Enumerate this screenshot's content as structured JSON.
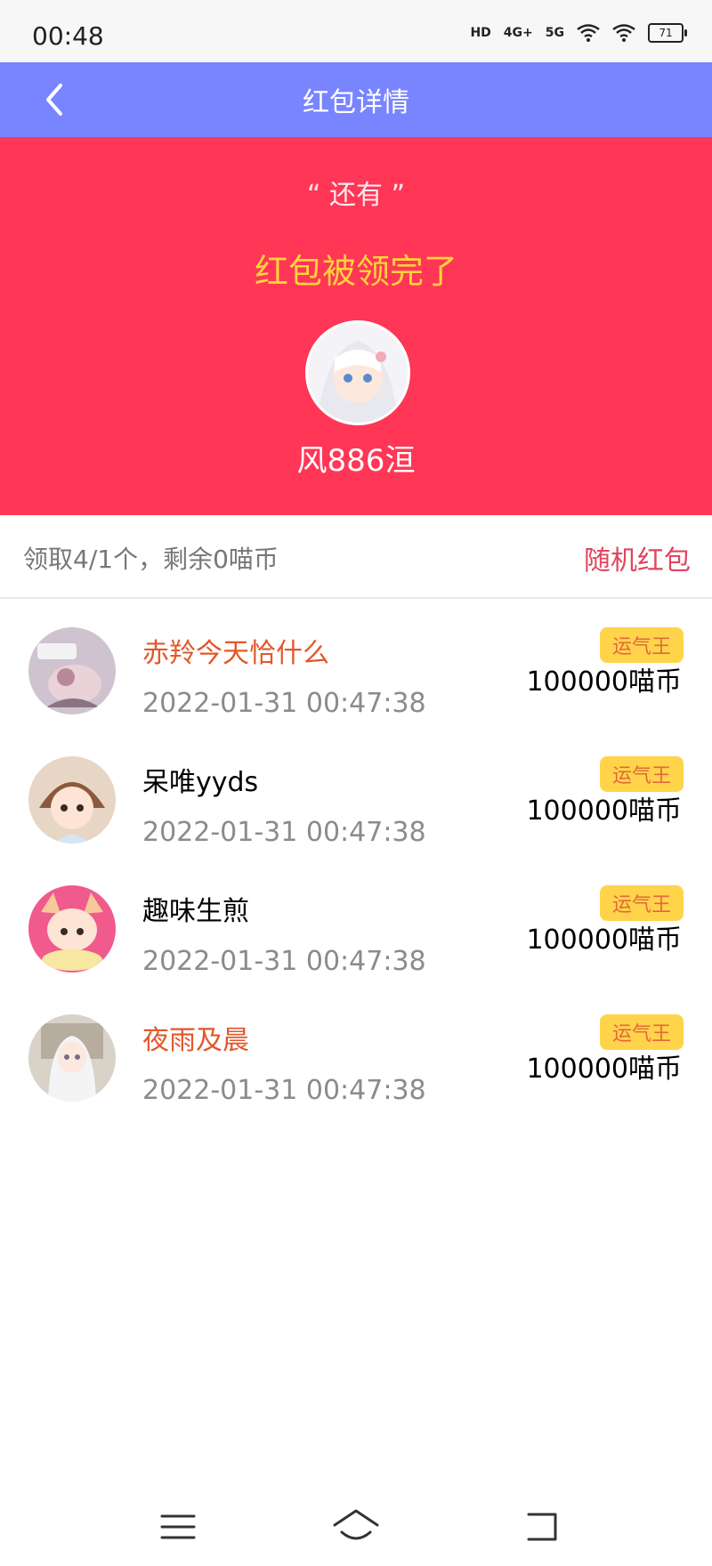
{
  "status_bar": {
    "time": "00:48",
    "icons": [
      "HD",
      "4G",
      "5G",
      "wifi-icon",
      "wifi-icon"
    ],
    "labels": {
      "hd": "HD",
      "g4": "4G+",
      "g5": "5G"
    },
    "battery": "71"
  },
  "header": {
    "title": "红包详情"
  },
  "hero": {
    "quote": "“ 还有 ”",
    "status": "红包被领完了",
    "sender_name": "风886洹"
  },
  "summary": {
    "text": "领取4/1个，剩余0喵币",
    "type": "随机红包"
  },
  "recipients": [
    {
      "name": "赤羚今天恰什么",
      "time": "2022-01-31 00:47:38",
      "badge": "运气王",
      "amount": "100000喵币",
      "name_color": "#e2572a"
    },
    {
      "name": "呆唯yyds",
      "time": "2022-01-31 00:47:38",
      "badge": "运气王",
      "amount": "100000喵币",
      "name_color": "#000000"
    },
    {
      "name": "趣味生煎",
      "time": "2022-01-31 00:47:38",
      "badge": "运气王",
      "amount": "100000喵币",
      "name_color": "#000000"
    },
    {
      "name": "夜雨及晨",
      "time": "2022-01-31 00:47:38",
      "badge": "运气王",
      "amount": "100000喵币",
      "name_color": "#e2572a"
    }
  ],
  "colors": {
    "header_bg": "#7885ff",
    "hero_bg": "#ff3656",
    "hero_status": "#ffd33b",
    "summary_type": "#e2445e",
    "badge_bg": "#ffd44b"
  }
}
